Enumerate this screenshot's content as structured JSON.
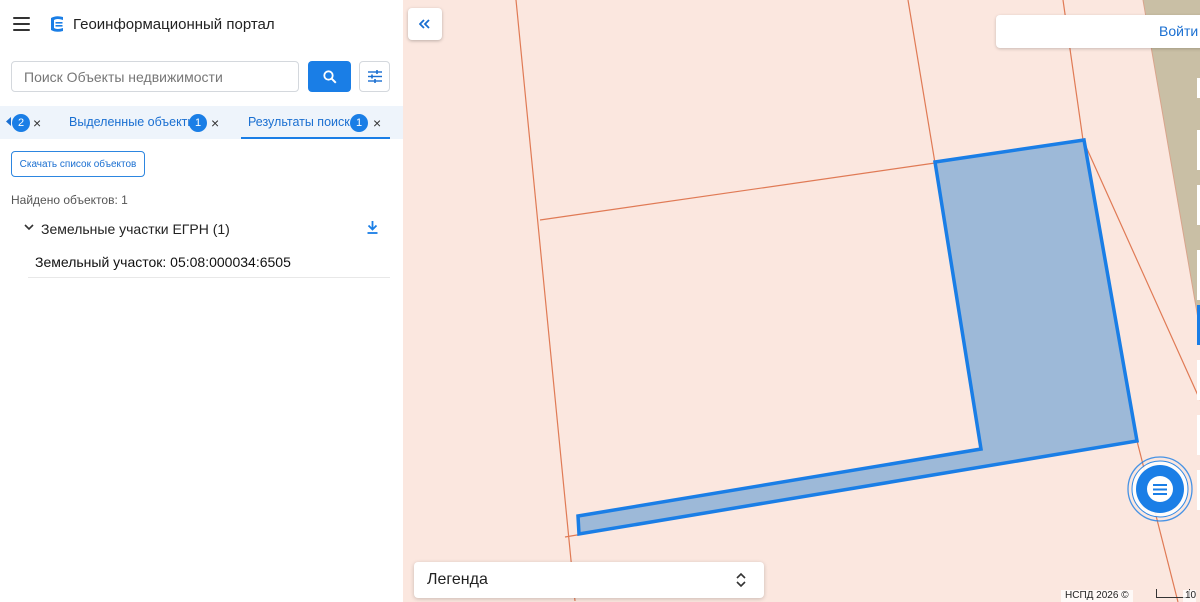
{
  "app": {
    "title": "Геоинформационный портал",
    "icons": {
      "menu": "hamburger-icon",
      "logo": "portal-logo-icon"
    }
  },
  "search": {
    "placeholder": "Поиск Объекты недвижимости",
    "value": "",
    "button_icon": "search-icon",
    "filter_icon": "filter-sliders-icon"
  },
  "tabs": [
    {
      "label": "",
      "count": "2"
    },
    {
      "label": "Выделенные объекты",
      "count": "1"
    },
    {
      "label": "Результаты поиска",
      "count": "1",
      "active": true
    }
  ],
  "results": {
    "download_label": "Скачать список объектов",
    "found_text": "Найдено объектов: 1",
    "group_title": "Земельные участки ЕГРН (1)",
    "items": [
      {
        "label": "Земельный участок: 05:08:000034:6505"
      }
    ]
  },
  "map": {
    "login_label": "Войти",
    "legend_label": "Легенда",
    "attribution": "НСПД 2026 ©",
    "scale_label": "10",
    "colors": {
      "background": "#fbe7df",
      "parcel_border": "#e07a55",
      "selected_fill": "#9db9d8",
      "selected_stroke": "#1a7ee6",
      "road": "#c9bfa5"
    }
  }
}
